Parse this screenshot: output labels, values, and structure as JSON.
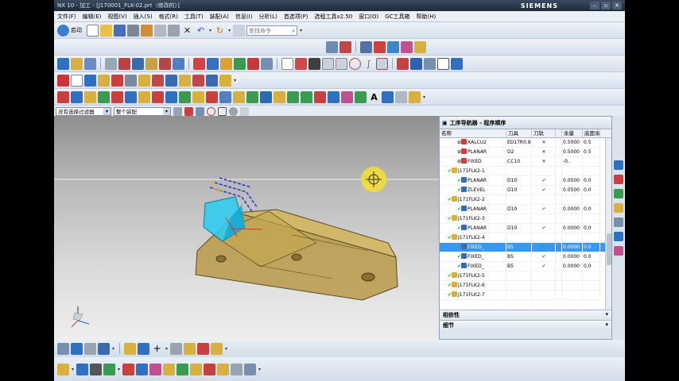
{
  "titlebar": {
    "title": "NX 10 - 加工 - [J170001_FLK-02.prt（修改的）]",
    "brand": "SIEMENS"
  },
  "menu": [
    "文件(F)",
    "编辑(E)",
    "视图(V)",
    "插入(S)",
    "格式(R)",
    "工具(T)",
    "装配(A)",
    "信息(I)",
    "分析(L)",
    "首选项(P)",
    "选程工具v2.50",
    "窗口(O)",
    "GC工具箱",
    "帮助(H)"
  ],
  "toolbar": {
    "start_label": "启动",
    "search_placeholder": "查找命令"
  },
  "selection_bar": {
    "filter": "没有选择过滤器",
    "scope": "整个装配"
  },
  "navigator": {
    "title": "工序导航器 - 程序顺序",
    "columns": [
      "名称",
      "刀具",
      "刀轨",
      "",
      "余量",
      "底面余"
    ],
    "rows": [
      {
        "name": "XALCU2",
        "tool": "ED1TR0.8",
        "path": "✕",
        "flag": "",
        "stock": "0.5000",
        "floor": "0.5",
        "status": "err"
      },
      {
        "name": "PLANAR",
        "tool": "D2",
        "path": "✕",
        "flag": "",
        "stock": "0.5000",
        "floor": "0.5",
        "status": "err"
      },
      {
        "name": "FIXED",
        "tool": "CC10",
        "path": "✕",
        "flag": "",
        "stock": "-0.",
        "floor": "",
        "status": "err"
      },
      {
        "name": "J171FLK2-1",
        "tool": "",
        "path": "",
        "flag": "",
        "stock": "",
        "floor": "",
        "status": "group"
      },
      {
        "name": "PLANAR",
        "tool": "D10",
        "path": "✔",
        "flag": "",
        "stock": "0.0500",
        "floor": "0.0",
        "status": "ok"
      },
      {
        "name": "ZLEVEL",
        "tool": "D10",
        "path": "✔",
        "flag": "",
        "stock": "0.0500",
        "floor": "0.0",
        "status": "ok"
      },
      {
        "name": "J171FLK2-2",
        "tool": "",
        "path": "",
        "flag": "",
        "stock": "",
        "floor": "",
        "status": "group"
      },
      {
        "name": "PLANAR",
        "tool": "D10",
        "path": "✔",
        "flag": "",
        "stock": "0.0000",
        "floor": "0.0",
        "status": "ok"
      },
      {
        "name": "J171FLK2-3",
        "tool": "",
        "path": "",
        "flag": "",
        "stock": "",
        "floor": "",
        "status": "group"
      },
      {
        "name": "PLANAR",
        "tool": "D10",
        "path": "✔",
        "flag": "",
        "stock": "0.0000",
        "floor": "0.0",
        "status": "ok"
      },
      {
        "name": "J171FLK2-4",
        "tool": "",
        "path": "",
        "flag": "",
        "stock": "",
        "floor": "",
        "status": "group"
      },
      {
        "name": "FIXED_",
        "tool": "B5",
        "path": "✔",
        "flag": "",
        "stock": "0.0000",
        "floor": "0.0",
        "status": "sel"
      },
      {
        "name": "FIXED_",
        "tool": "B5",
        "path": "✔",
        "flag": "",
        "stock": "0.0000",
        "floor": "0.0",
        "status": "ok"
      },
      {
        "name": "FIXED_",
        "tool": "B5",
        "path": "✔",
        "flag": "",
        "stock": "0.0000",
        "floor": "0.0",
        "status": "ok"
      },
      {
        "name": "J171FLK2-5",
        "tool": "",
        "path": "",
        "flag": "",
        "stock": "",
        "floor": "",
        "status": "group"
      },
      {
        "name": "J171FLK2-6",
        "tool": "",
        "path": "",
        "flag": "",
        "stock": "",
        "floor": "",
        "status": "group"
      },
      {
        "name": "J171FLK2-7",
        "tool": "",
        "path": "",
        "flag": "",
        "stock": "",
        "floor": "",
        "status": "group"
      }
    ],
    "panes": [
      "相依性",
      "细节"
    ]
  },
  "colors": {
    "accent": "#3399ff",
    "ok": "#1fa31f",
    "part": "#c8a64a",
    "tool": "#33ccee"
  }
}
